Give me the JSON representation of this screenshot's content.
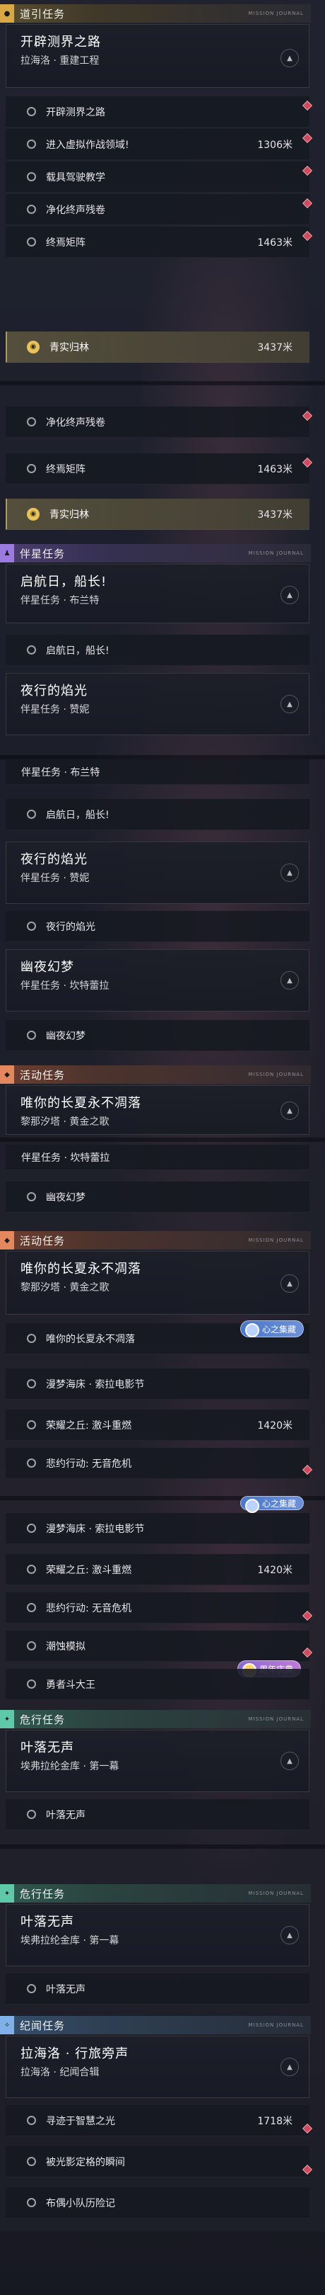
{
  "mini_tag": "MISSION JOURNAL",
  "categories": {
    "guide": "道引任务",
    "companion": "伴星任务",
    "event": "活动任务",
    "danger": "危行任务",
    "chronicle": "纪闻任务"
  },
  "quests": {
    "q1": {
      "title": "开辟测界之路",
      "sub": "拉海洛 · 重建工程"
    },
    "q2": {
      "title": "启航日，船长!",
      "sub": "伴星任务 · 布兰特"
    },
    "q3": {
      "title": "夜行的焰光",
      "sub": "伴星任务 · 赞妮"
    },
    "q4": {
      "title": "幽夜幻梦",
      "sub": "伴星任务 · 坎特蕾拉"
    },
    "q5": {
      "title": "唯你的长夏永不凋落",
      "sub": "黎那汐塔 · 黄金之歌"
    },
    "q6": {
      "title": "叶落无声",
      "sub": "埃弗拉纶金库 · 第一幕"
    },
    "q7": {
      "title": "拉海洛 · 行旅旁声",
      "sub": "拉海洛 · 纪闻合辑"
    }
  },
  "rows": {
    "r_kaipi": "开辟测界之路",
    "r_jinru": "进入虚拟作战领域!",
    "r_jinru_dist": "1306米",
    "r_zaiju": "载具驾驶教学",
    "r_jinghua": "净化终声残卷",
    "r_zhongyan": "终焉矩阵",
    "r_zhongyan_dist": "1463米",
    "r_qingshi": "青实归林",
    "r_qingshi_dist": "3437米",
    "r_qihang": "启航日，船长!",
    "r_yexing": "夜行的焰光",
    "r_youye": "幽夜幻梦",
    "r_weini": "唯你的长夏永不凋落",
    "r_manmeng": "漫梦海床 · 索拉电影节",
    "r_ronghui": "荣耀之丘: 激斗重燃",
    "r_ronghui_dist": "1420米",
    "r_beiwei": "悲约行动: 无音危机",
    "r_chaoxian": "潮蚀模拟",
    "r_yongzhe": "勇者斗大王",
    "r_yeluo": "叶落无声",
    "r_xunzhao": "寻迹于智慧之光",
    "r_xunzhao_dist": "1718米",
    "r_beiguang": "被光影定格的瞬间",
    "r_buou": "布偶小队历险记"
  },
  "badges": {
    "heart": "心之集藏",
    "anniv": "周年庆典"
  },
  "colors": {
    "accent_gold": "#e8c25a",
    "marker_red": "#d2495a"
  }
}
